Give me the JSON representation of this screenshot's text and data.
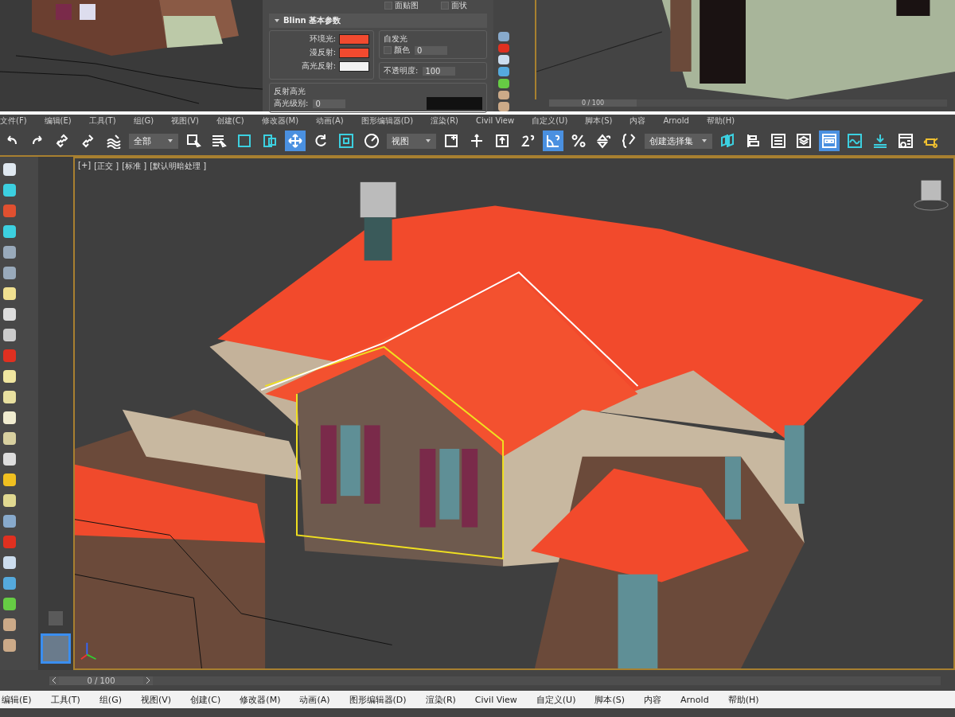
{
  "material_panel": {
    "checkboxes": [
      {
        "label": "面贴图",
        "checked": false
      },
      {
        "label": "面状",
        "checked": false
      }
    ],
    "rollout_title": "Blinn 基本参数",
    "colors": [
      {
        "label": "环境光:",
        "color": "#f24a2f"
      },
      {
        "label": "漫反射:",
        "color": "#f24a2f"
      },
      {
        "label": "高光反射:",
        "color": "#f2f2f2"
      }
    ],
    "self_illumination": {
      "title": "自发光",
      "checkbox": {
        "label": "颜色",
        "checked": false
      },
      "value": "0"
    },
    "opacity": {
      "label": "不透明度:",
      "value": "100"
    },
    "specular": {
      "title": "反射高光",
      "label": "高光级别:",
      "value": "0"
    }
  },
  "top_viewport": {
    "frame": "0 / 100",
    "level": 0
  },
  "menu_top": [
    "文件(F)",
    "编辑(E)",
    "工具(T)",
    "组(G)",
    "视图(V)",
    "创建(C)",
    "修改器(M)",
    "动画(A)",
    "图形编辑器(D)",
    "渲染(R)",
    "Civil View",
    "自定义(U)",
    "脚本(S)",
    "内容",
    "Arnold",
    "帮助(H)"
  ],
  "toolbar": [
    {
      "kind": "button",
      "selected": false
    },
    {
      "kind": "button",
      "selected": false
    },
    {
      "kind": "button",
      "selected": false
    },
    {
      "kind": "button",
      "selected": false
    },
    {
      "kind": "button",
      "selected": false
    },
    {
      "kind": "dropdown",
      "value": "全部"
    },
    {
      "kind": "button",
      "selected": false
    },
    {
      "kind": "button",
      "selected": false
    },
    {
      "kind": "button",
      "selected": false
    },
    {
      "kind": "button",
      "selected": false
    },
    {
      "kind": "button",
      "selected": true
    },
    {
      "kind": "button",
      "selected": false
    },
    {
      "kind": "button",
      "selected": false
    },
    {
      "kind": "button",
      "selected": false
    },
    {
      "kind": "dropdown",
      "value": "视图"
    },
    {
      "kind": "button",
      "selected": false
    },
    {
      "kind": "button",
      "selected": false
    },
    {
      "kind": "button",
      "selected": false
    },
    {
      "kind": "button",
      "selected": false
    },
    {
      "kind": "button",
      "selected": true
    },
    {
      "kind": "button",
      "selected": false
    },
    {
      "kind": "button",
      "selected": false
    },
    {
      "kind": "button",
      "selected": false
    },
    {
      "kind": "dropdown",
      "value": "创建选择集"
    },
    {
      "kind": "button",
      "selected": false
    },
    {
      "kind": "button",
      "selected": false
    },
    {
      "kind": "button",
      "selected": false
    },
    {
      "kind": "button",
      "selected": false
    },
    {
      "kind": "button",
      "selected": true
    },
    {
      "kind": "button",
      "selected": false
    },
    {
      "kind": "button",
      "selected": false
    },
    {
      "kind": "button",
      "selected": false
    },
    {
      "kind": "button",
      "selected": false
    }
  ],
  "viewport": {
    "labels": [
      "[+]",
      "[正交 ]",
      "[标准 ]",
      "[默认明暗处理 ]"
    ]
  },
  "time_slider": {
    "frame": "0 / 100",
    "level": 0
  },
  "menu_bottom": [
    "编辑(E)",
    "工具(T)",
    "组(G)",
    "视图(V)",
    "创建(C)",
    "修改器(M)",
    "动画(A)",
    "图形编辑器(D)",
    "渲染(R)",
    "Civil View",
    "自定义(U)",
    "脚本(S)",
    "内容",
    "Arnold",
    "帮助(H)"
  ]
}
